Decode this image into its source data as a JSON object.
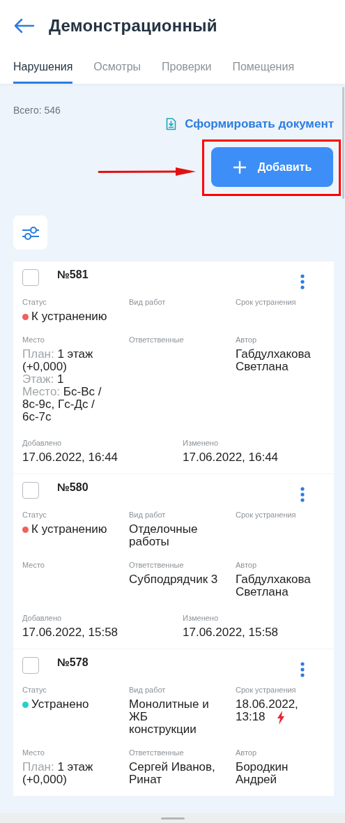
{
  "header": {
    "title": "Демонстрационный"
  },
  "tabs": [
    {
      "label": "Нарушения",
      "selected": true
    },
    {
      "label": "Осмотры",
      "selected": false
    },
    {
      "label": "Проверки",
      "selected": false
    },
    {
      "label": "Помещения",
      "selected": false
    }
  ],
  "total": "Всего: 546",
  "document_link": "Сформировать документ",
  "add_button": {
    "label": "Добавить",
    "highlighted": true
  },
  "cards": [
    {
      "number": "№581",
      "checked": false,
      "fields": [
        {
          "kind": "status",
          "label": "Статус",
          "value": "К устранению",
          "color": "#f0605f"
        },
        {
          "kind": "text",
          "label": "Вид работ"
        },
        {
          "kind": "deadline",
          "label": "Срок устранения"
        },
        {
          "kind": "location",
          "label": "Место",
          "parts": [
            {
              "label": "План:",
              "value": "1 этаж (+0,000)"
            },
            {
              "label": "Этаж:",
              "value": "1"
            },
            {
              "label": "Место:",
              "value": "Бс-Вс / 8с-9с, Гс-Дс / 6с-7с"
            }
          ]
        },
        {
          "kind": "text",
          "label": "Ответственные"
        },
        {
          "kind": "text",
          "label": "Автор",
          "value": "Габдулхакова Светлана"
        }
      ],
      "dates": [
        {
          "label": "Добавлено",
          "value": "17.06.2022, 16:44"
        },
        {
          "label": "Изменено",
          "value": "17.06.2022, 16:44"
        }
      ]
    },
    {
      "number": "№580",
      "checked": false,
      "fields": [
        {
          "kind": "status",
          "label": "Статус",
          "value": "К устранению",
          "color": "#f0605f"
        },
        {
          "kind": "text",
          "label": "Вид работ",
          "value": "Отделочные работы"
        },
        {
          "kind": "deadline",
          "label": "Срок устранения"
        },
        {
          "kind": "location",
          "label": "Место"
        },
        {
          "kind": "text",
          "label": "Ответственные",
          "value": "Субподрядчик 3"
        },
        {
          "kind": "text",
          "label": "Автор",
          "value": "Габдулхакова Светлана"
        }
      ],
      "dates": [
        {
          "label": "Добавлено",
          "value": "17.06.2022, 15:58"
        },
        {
          "label": "Изменено",
          "value": "17.06.2022, 15:58"
        }
      ]
    },
    {
      "number": "№578",
      "checked": false,
      "fields": [
        {
          "kind": "status",
          "label": "Статус",
          "value": "Устранено",
          "color": "#22d3c5"
        },
        {
          "kind": "text",
          "label": "Вид работ",
          "value": "Монолитные и ЖБ конструкции"
        },
        {
          "kind": "deadline",
          "label": "Срок устранения",
          "value": "18.06.2022, 13:18",
          "urgent": true
        },
        {
          "kind": "location",
          "label": "Место",
          "parts": [
            {
              "label": "План:",
              "value": "1 этаж (+0,000)"
            }
          ]
        },
        {
          "kind": "text",
          "label": "Ответственные",
          "value": "Сергей Иванов, Ринат"
        },
        {
          "kind": "text",
          "label": "Автор",
          "value": "Бородкин Андрей"
        }
      ]
    }
  ]
}
